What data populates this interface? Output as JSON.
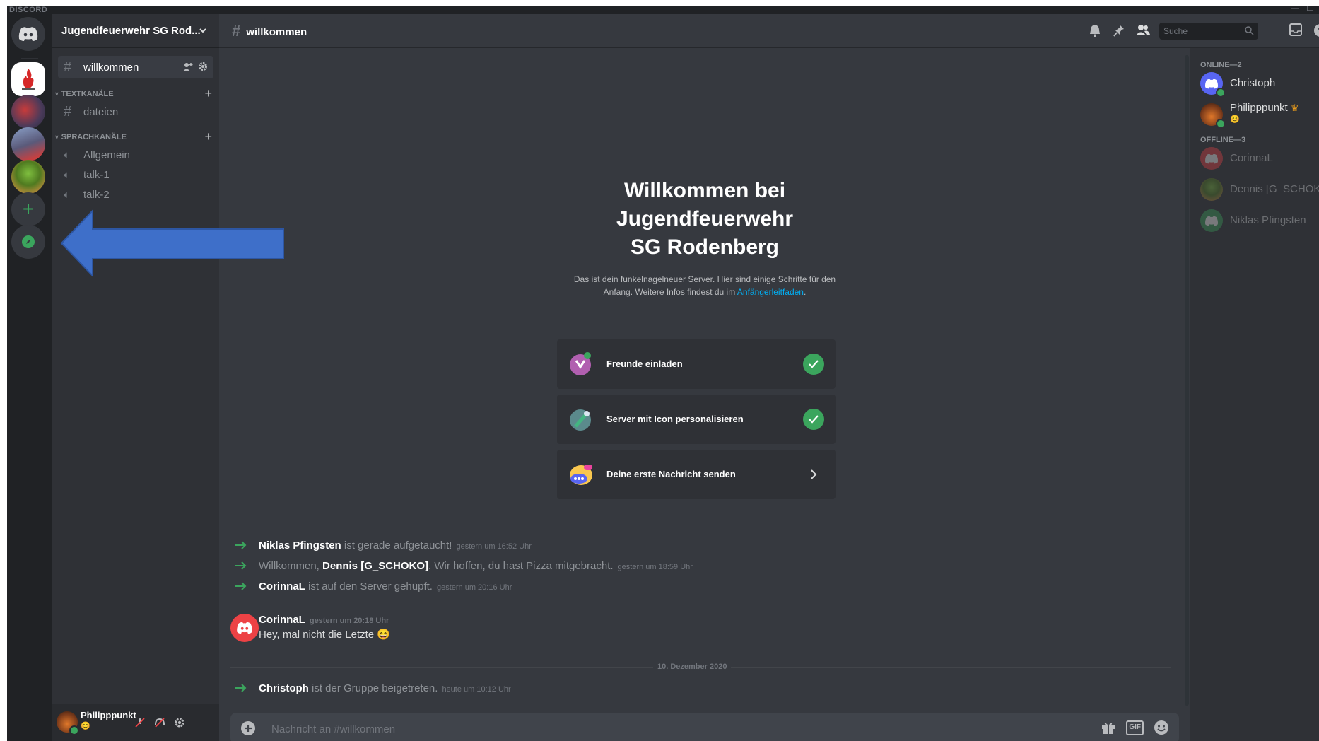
{
  "app": {
    "brand": "DISCORD"
  },
  "guild": {
    "name": "Jugendfeuerwehr SG Rod..."
  },
  "sidebar": {
    "top_channel": "willkommen",
    "categories": [
      {
        "label": "TEXTKANÄLE",
        "channels": [
          "dateien"
        ]
      },
      {
        "label": "SPRACHKANÄLE",
        "channels": [
          "Allgemein",
          "talk-1",
          "talk-2"
        ]
      }
    ]
  },
  "user": {
    "name": "Philipppunkt",
    "badge": "😊"
  },
  "header": {
    "channel": "willkommen",
    "search_placeholder": "Suche"
  },
  "welcome": {
    "title": "Willkommen bei Jugendfeuerwehr SG Rodenberg",
    "desc": "Das ist dein funkelnagelneuer Server. Hier sind einige Schritte für den Anfang. Weitere Infos findest du im ",
    "link": "Anfängerleitfaden",
    "desc_end": ".",
    "cards": [
      {
        "label": "Freunde einladen",
        "done": true
      },
      {
        "label": "Server mit Icon personalisieren",
        "done": true
      },
      {
        "label": "Deine erste Nachricht senden",
        "done": false
      }
    ]
  },
  "messages": {
    "sys1": {
      "name": "Niklas Pfingsten",
      "text": " ist gerade aufgetaucht!",
      "time": "gestern um 16:52 Uhr"
    },
    "sys2": {
      "pre": "Willkommen, ",
      "name": "Dennis [G_SCHOKO]",
      "text": ". Wir hoffen, du hast Pizza mitgebracht.",
      "time": "gestern um 18:59 Uhr"
    },
    "sys3": {
      "name": "CorinnaL",
      "text": " ist auf den Server gehüpft.",
      "time": "gestern um 20:16 Uhr"
    },
    "msg1": {
      "author": "CorinnaL",
      "time": "gestern um 20:18 Uhr",
      "text": "Hey, mal nicht die Letzte",
      "emoji": "😄"
    },
    "date_divider": "10. Dezember 2020",
    "sys4": {
      "name": "Christoph",
      "text": " ist der Gruppe beigetreten.",
      "time": "heute um 10:12 Uhr"
    }
  },
  "composer": {
    "placeholder": "Nachricht an #willkommen",
    "gif": "GIF"
  },
  "members": {
    "online_header": "ONLINE—2",
    "online": [
      {
        "name": "Christoph"
      },
      {
        "name": "Philipppunkt",
        "crown": "♛",
        "badge": "😊"
      }
    ],
    "offline_header": "OFFLINE—3",
    "offline": [
      {
        "name": "CorinnaL"
      },
      {
        "name": "Dennis [G_SCHOKO]"
      },
      {
        "name": "Niklas Pfingsten"
      }
    ]
  },
  "colors": {
    "accent": "#5865f2",
    "green": "#3ba55d",
    "link": "#00b0f4",
    "arrow": "#3e6fc9"
  }
}
